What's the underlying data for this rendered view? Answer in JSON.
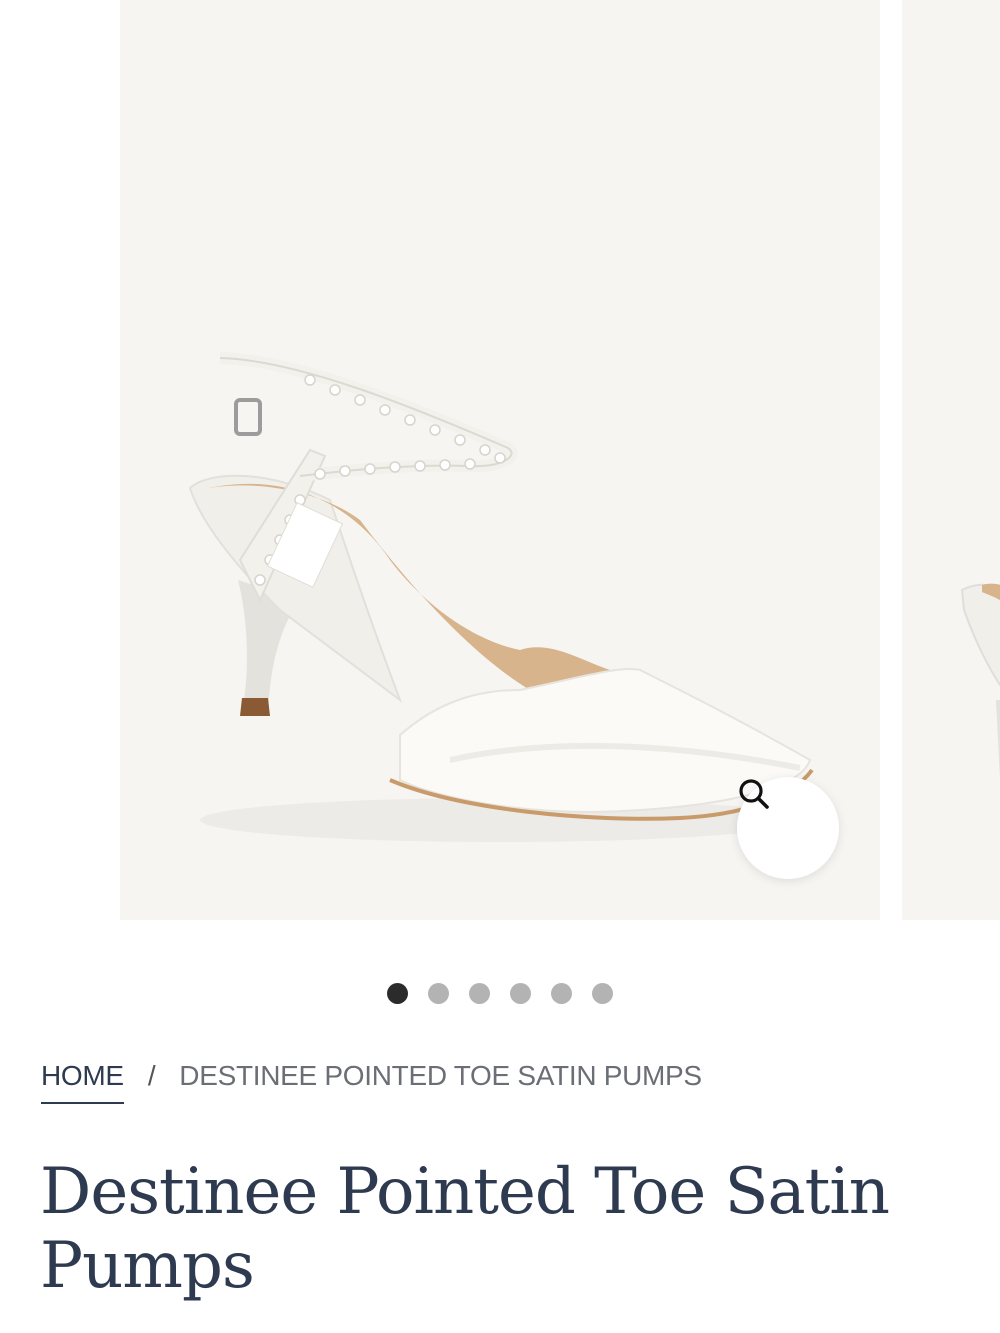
{
  "gallery": {
    "slide_count": 6,
    "active_slide": 1,
    "zoom_icon": "magnifier-icon",
    "image_alt": "Destinee Pointed Toe Satin Pumps"
  },
  "breadcrumb": {
    "home": "HOME",
    "separator": "/",
    "current": "DESTINEE POINTED TOE SATIN PUMPS"
  },
  "product": {
    "title": "Destinee Pointed Toe Satin Pumps"
  },
  "colors": {
    "title": "#2e3a4f",
    "image_bg": "#f6f5f2",
    "dot_active": "#2b2b2b",
    "dot_inactive": "#b3b3b3"
  }
}
